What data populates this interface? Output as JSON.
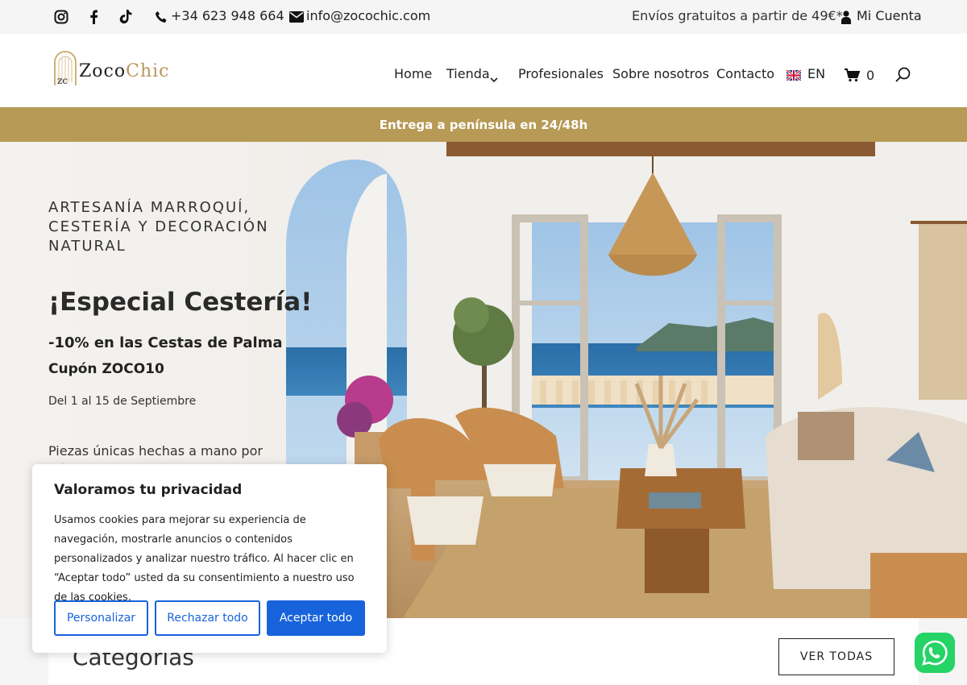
{
  "topbar": {
    "phone": "+34 623 948 664",
    "email": "info@zocochic.com",
    "shipping": "Envíos gratuitos a partir de 49€*",
    "account": "Mi Cuenta",
    "icons": [
      "instagram-icon",
      "facebook-icon",
      "tiktok-icon",
      "phone-icon",
      "mail-icon",
      "user-icon"
    ]
  },
  "header": {
    "logo_prefix": "Zoco",
    "logo_suffix": "Chic",
    "nav": [
      "Home",
      "Tienda",
      "Profesionales",
      "Sobre nosotros",
      "Contacto"
    ],
    "language": "EN",
    "cart_count": "0"
  },
  "banner": {
    "text": "Entrega a península en 24/48h",
    "color": "#b79a55"
  },
  "hero": {
    "kicker": "ARTESANÍA MARROQUÍ, CESTERÍA Y DECORACIÓN NATURAL",
    "title": "¡Especial Cestería!",
    "subtitle": "-10% en las Cestas de Palma",
    "coupon": "Cupón ZOCO10",
    "dates": "Del 1 al 15 de Septiembre",
    "body": "Piezas únicas hechas a mano por artesanos"
  },
  "categories": {
    "title": "Categorías",
    "button": "VER TODAS"
  },
  "cookie": {
    "title": "Valoramos tu privacidad",
    "body": "Usamos cookies para mejorar su experiencia de navegación, mostrarle anuncios o contenidos personalizados y analizar nuestro tráfico. Al hacer clic en “Aceptar todo” usted da su consentimiento a nuestro uso de las cookies.",
    "customize": "Personalizar",
    "reject": "Rechazar todo",
    "accept": "Aceptar todo",
    "accent": "#1863dc"
  }
}
